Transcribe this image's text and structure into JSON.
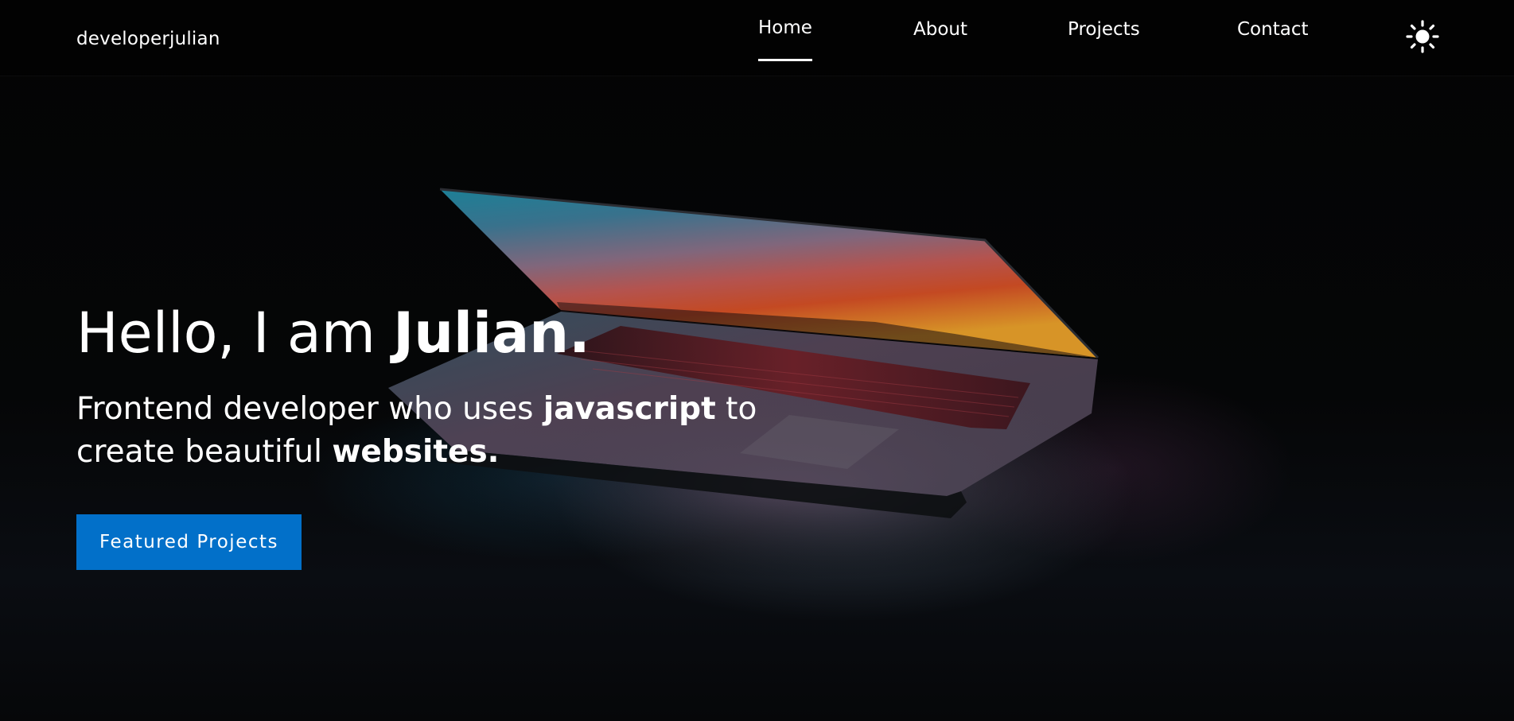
{
  "brand": {
    "name": "developerjulian"
  },
  "nav": {
    "items": [
      {
        "label": "Home",
        "active": true
      },
      {
        "label": "About",
        "active": false
      },
      {
        "label": "Projects",
        "active": false
      },
      {
        "label": "Contact",
        "active": false
      }
    ],
    "theme_toggle_icon": "sun-icon"
  },
  "hero": {
    "greeting_prefix": "Hello, I am ",
    "greeting_name": "Julian.",
    "subtitle_part1": "Frontend developer who uses ",
    "subtitle_bold1": "javascript",
    "subtitle_part2": " to create beautiful ",
    "subtitle_bold2": "websites.",
    "cta_label": "Featured Projects",
    "image_icon": "laptop-image"
  },
  "colors": {
    "background": "#000000",
    "accent": "#0270c9",
    "text": "#ffffff"
  }
}
